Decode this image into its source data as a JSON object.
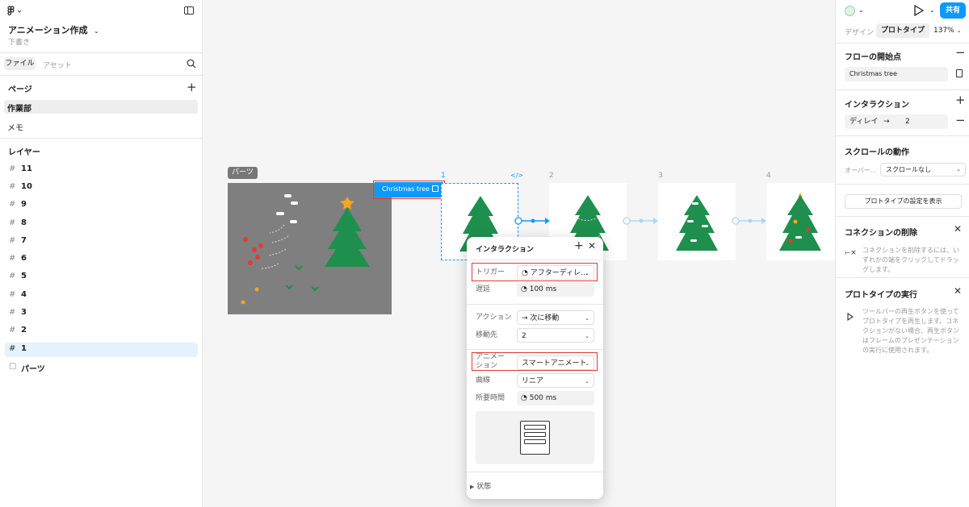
{
  "left": {
    "file_name": "アニメーション作成",
    "file_status": "下書き",
    "tabs": [
      "ファイル",
      "アセット"
    ],
    "pages_title": "ページ",
    "pages": [
      "作業部",
      "メモ"
    ],
    "layers_title": "レイヤー",
    "layers": [
      "11",
      "10",
      "9",
      "8",
      "7",
      "6",
      "5",
      "4",
      "3",
      "2",
      "1",
      "パーツ"
    ]
  },
  "canvas": {
    "parts_label": "パーツ",
    "flow_badge": "Christmas tree",
    "frame_numbers": [
      "1",
      "2",
      "3",
      "4"
    ],
    "code_icon": "</>"
  },
  "popup": {
    "title": "インタラクション",
    "trigger_label": "トリガー",
    "trigger_value": "アフターディレ...",
    "delay_label": "遅延",
    "delay_value": "100 ms",
    "action_label": "アクション",
    "action_value": "次に移動",
    "dest_label": "移動先",
    "dest_value": "2",
    "animation_label": "アニメーション",
    "animation_value": "スマートアニメート",
    "curve_label": "曲線",
    "curve_value": "リニア",
    "duration_label": "所要時間",
    "duration_value": "500 ms",
    "state_label": "状態"
  },
  "right": {
    "share_label": "共有",
    "tab_design": "デザイン",
    "tab_prototype": "プロトタイプ",
    "zoom": "137%",
    "flow_start_title": "フローの開始点",
    "flow_start_value": "Christmas tree",
    "interaction_title": "インタラクション",
    "interaction_trigger": "ディレイ",
    "interaction_arrow": "→",
    "interaction_target": "2",
    "scroll_title": "スクロールの動作",
    "overflow_label": "オーバー...",
    "overflow_value": "スクロールなし",
    "proto_settings_button": "プロトタイプの設定を表示",
    "delete_conn_title": "コネクションの削除",
    "delete_conn_text": "コネクションを削除するには、いずれかの端をクリックしてドラッグします。",
    "run_proto_title": "プロトタイプの実行",
    "run_proto_text": "ツールバーの再生ボタンを使ってプロトタイプを再生します。コネクションがない場合、再生ボタンはフレームのプレゼンテーションの実行に使用されます。"
  },
  "colors": {
    "accent": "#0d99ff",
    "tree_green": "#1f8f4e",
    "highlight_red": "#e53935",
    "parts_bg": "#7f7f7f"
  }
}
